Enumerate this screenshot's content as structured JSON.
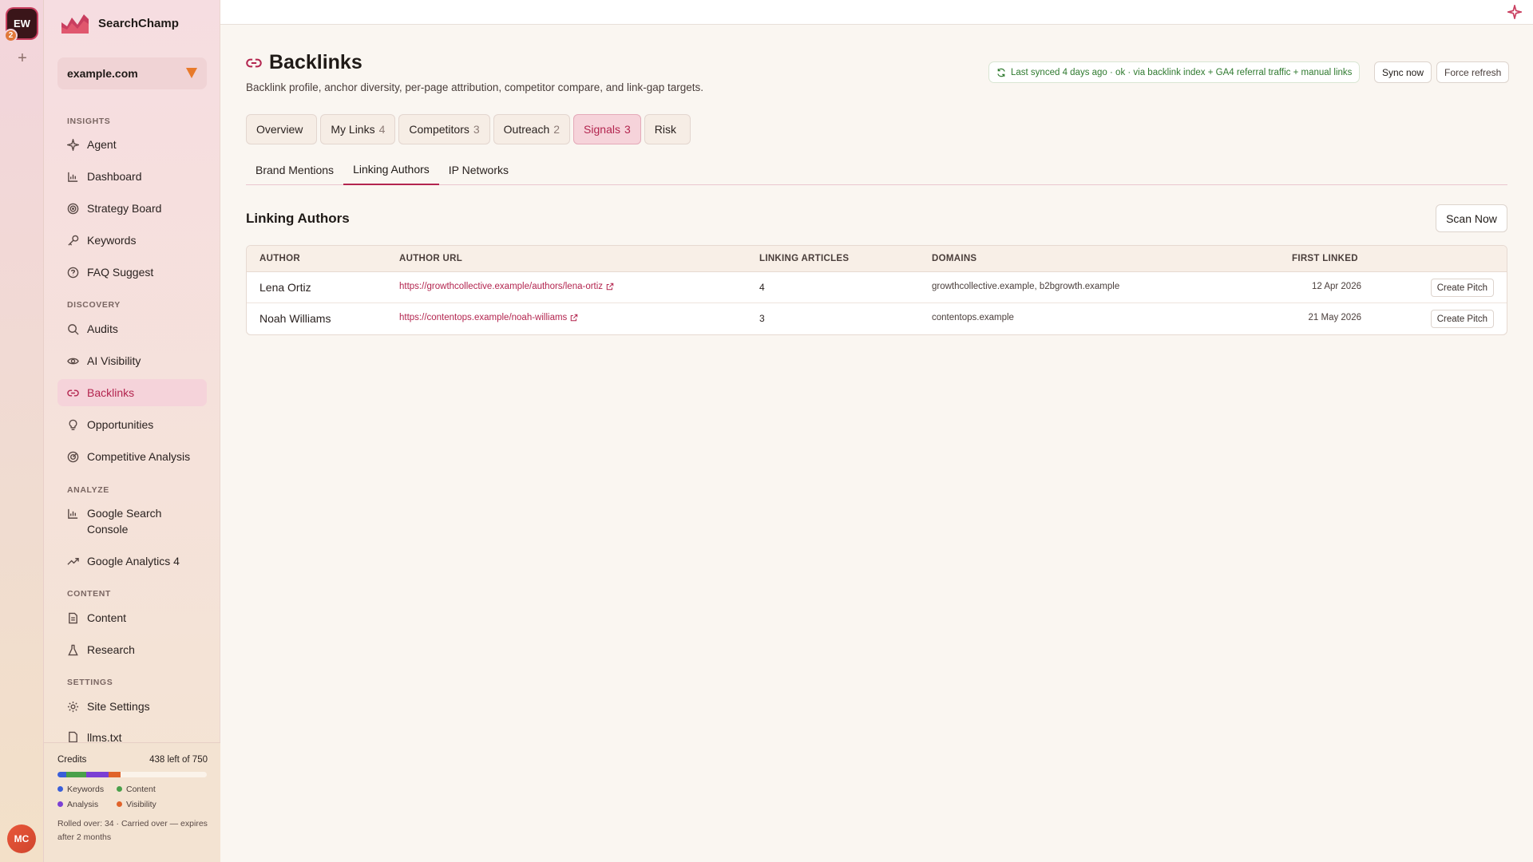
{
  "workspace": {
    "initials": "EW",
    "notification_count": "2",
    "user_initials": "MC"
  },
  "brand": {
    "name": "SearchChamp"
  },
  "site": {
    "selected": "example.com"
  },
  "sidebar": {
    "sections": {
      "insights": "INSIGHTS",
      "discovery": "DISCOVERY",
      "analyze": "ANALYZE",
      "content": "CONTENT",
      "settings": "SETTINGS"
    },
    "items": {
      "agent": "Agent",
      "dashboard": "Dashboard",
      "strategy": "Strategy Board",
      "keywords": "Keywords",
      "faq": "FAQ Suggest",
      "audits": "Audits",
      "ai_visibility": "AI Visibility",
      "backlinks": "Backlinks",
      "opportunities": "Opportunities",
      "competitive": "Competitive Analysis",
      "gsc": "Google Search Console",
      "ga4": "Google Analytics 4",
      "content": "Content",
      "research": "Research",
      "site_settings": "Site Settings",
      "llms": "llms.txt"
    }
  },
  "credits": {
    "label": "Credits",
    "remaining": "438 left of 750",
    "segments": [
      {
        "name": "Keywords",
        "fraction": 0.06,
        "color": "#3a5fd9"
      },
      {
        "name": "Content",
        "fraction": 0.13,
        "color": "#4aa04a"
      },
      {
        "name": "Analysis",
        "fraction": 0.15,
        "color": "#7b3fd4"
      },
      {
        "name": "Visibility",
        "fraction": 0.08,
        "color": "#e0632a"
      }
    ],
    "legend": {
      "keywords": "Keywords",
      "content": "Content",
      "analysis": "Analysis",
      "visibility": "Visibility"
    },
    "rollover": "Rolled over: 34 · Carried over — expires after 2 months"
  },
  "page": {
    "title": "Backlinks",
    "subtitle": "Backlink profile, anchor diversity, per-page attribution, competitor compare, and link-gap targets.",
    "sync_status": "Last synced 4 days ago · ok · via backlink index + GA4 referral traffic + manual links",
    "sync_now": "Sync now",
    "force_refresh": "Force refresh"
  },
  "tabs": [
    {
      "label": "Overview",
      "count": ""
    },
    {
      "label": "My Links",
      "count": "4"
    },
    {
      "label": "Competitors",
      "count": "3"
    },
    {
      "label": "Outreach",
      "count": "2"
    },
    {
      "label": "Signals",
      "count": "3"
    },
    {
      "label": "Risk",
      "count": ""
    }
  ],
  "subtabs": [
    "Brand Mentions",
    "Linking Authors",
    "IP Networks"
  ],
  "section": {
    "title": "Linking Authors",
    "scan_button": "Scan Now"
  },
  "table": {
    "headers": {
      "author": "AUTHOR",
      "url": "AUTHOR URL",
      "articles": "LINKING ARTICLES",
      "domains": "DOMAINS",
      "first_linked": "FIRST LINKED"
    },
    "rows": [
      {
        "author": "Lena Ortiz",
        "url": "https://growthcollective.example/authors/lena-ortiz",
        "articles": "4",
        "domains": "growthcollective.example, b2bgrowth.example",
        "first_linked": "12 Apr 2026",
        "action": "Create Pitch"
      },
      {
        "author": "Noah Williams",
        "url": "https://contentops.example/noah-williams",
        "articles": "3",
        "domains": "contentops.example",
        "first_linked": "21 May 2026",
        "action": "Create Pitch"
      }
    ]
  }
}
